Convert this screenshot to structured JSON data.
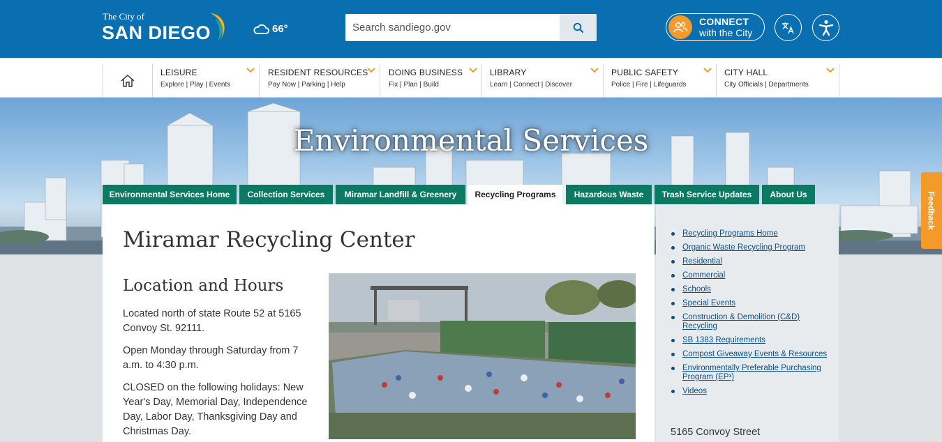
{
  "header": {
    "logo_small": "The City of",
    "logo_big": "SAN DIEGO",
    "weather_temp": "66°",
    "search_placeholder": "Search sandiego.gov",
    "connect_line1": "CONNECT",
    "connect_line2": "with the City",
    "colors": {
      "bar": "#0a6fb0",
      "accent": "#f39a2b"
    }
  },
  "nav": {
    "items": [
      {
        "title": "LEISURE",
        "sub": "Explore | Play | Events"
      },
      {
        "title": "RESIDENT RESOURCES",
        "sub": "Pay Now | Parking | Help"
      },
      {
        "title": "DOING BUSINESS",
        "sub": "Fix | Plan | Build"
      },
      {
        "title": "LIBRARY",
        "sub": "Learn | Connect | Discover"
      },
      {
        "title": "PUBLIC SAFETY",
        "sub": "Police | Fire | Lifeguards"
      },
      {
        "title": "CITY HALL",
        "sub": "City Officials | Departments"
      }
    ]
  },
  "hero": {
    "title": "Environmental Services"
  },
  "tabs": [
    {
      "label": "Environmental Services Home",
      "active": false
    },
    {
      "label": "Collection Services",
      "active": false
    },
    {
      "label": "Miramar Landfill & Greenery",
      "active": false
    },
    {
      "label": "Recycling Programs",
      "active": true
    },
    {
      "label": "Hazardous Waste",
      "active": false
    },
    {
      "label": "Trash Service Updates",
      "active": false
    },
    {
      "label": "About Us",
      "active": false
    }
  ],
  "main": {
    "title": "Miramar Recycling Center",
    "section_title": "Location and Hours",
    "paragraphs": [
      "Located north of state Route 52 at 5165 Convoy St. 92111.",
      "Open Monday through Saturday from 7 a.m. to 4:30 p.m.",
      "CLOSED on the following holidays: New Year's Day, Memorial Day, Independence Day, Labor Day, Thanksgiving Day and Christmas Day."
    ]
  },
  "sidebar": {
    "links": [
      "Recycling Programs Home",
      "Organic Waste Recycling Program",
      "Residential",
      "Commercial",
      "Schools",
      "Special Events",
      "Construction & Demolition (C&D) Recycling",
      "SB 1383 Requirements",
      "Compost Giveaway Events & Resources",
      "Environmentally Preferable Purchasing Program (EP³)",
      "Videos"
    ],
    "address": "5165 Convoy Street"
  },
  "feedback_label": "Feedback"
}
